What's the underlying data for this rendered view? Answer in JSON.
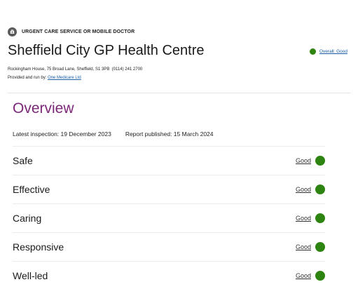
{
  "service": {
    "type_label": "URGENT CARE SERVICE OR MOBILE DOCTOR",
    "icon": "urgent-care-icon",
    "title": "Sheffield City GP Health Centre",
    "address": "Rockingham House, 75 Broad Lane, Sheffield, S1 3PB",
    "phone": "(0114) 241 2700",
    "provider_prefix": "Provided and run by:",
    "provider_name": "One Medicare Ltd"
  },
  "overall": {
    "label": "Overall: Good",
    "color": "#2d8410"
  },
  "overview": {
    "title": "Overview",
    "latest_inspection": "Latest inspection: 19 December 2023",
    "report_published": "Report published: 15 March 2024"
  },
  "ratings": [
    {
      "name": "Safe",
      "rating": "Good"
    },
    {
      "name": "Effective",
      "rating": "Good"
    },
    {
      "name": "Caring",
      "rating": "Good"
    },
    {
      "name": "Responsive",
      "rating": "Good"
    },
    {
      "name": "Well-led",
      "rating": "Good"
    }
  ],
  "colors": {
    "accent": "#7b2778",
    "good": "#2d8410",
    "link": "#1a5ea8"
  }
}
